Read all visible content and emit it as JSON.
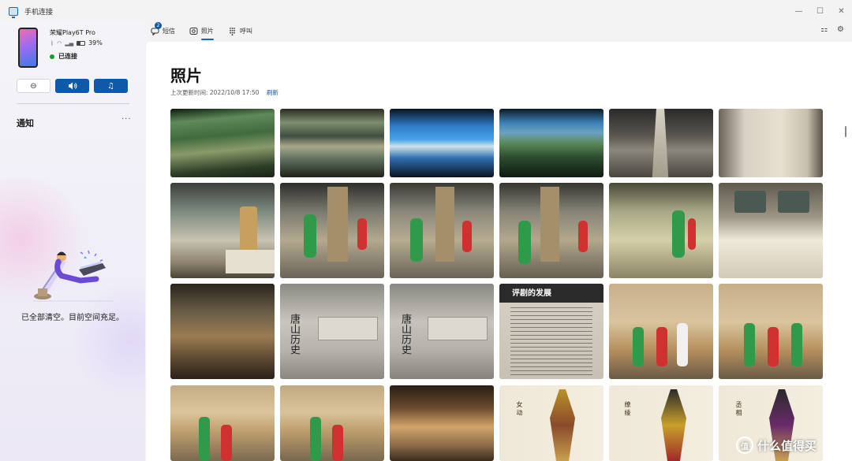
{
  "window": {
    "title": "手机连接",
    "controls": [
      "—",
      "☐",
      "✕"
    ]
  },
  "device": {
    "name": "荣耀Play6T Pro",
    "battery": "39%",
    "status": "已连接",
    "status_color": "#10a02b"
  },
  "controls": {
    "dnd_icon": "⊖",
    "volume_icon": "🔈",
    "music_icon": "♫"
  },
  "notifications": {
    "title": "通知",
    "more": "···",
    "empty_text": "已全部清空。目前空间充足。"
  },
  "tabs": [
    {
      "label": "短信",
      "icon": "message-icon",
      "badge": "2"
    },
    {
      "label": "照片",
      "icon": "photo-icon"
    },
    {
      "label": "呼叫",
      "icon": "dialpad-icon"
    }
  ],
  "active_tab": "照片",
  "main": {
    "title": "照片",
    "updated": "上次更新时间: 2022/10/8 17:50",
    "refresh": "刷新"
  },
  "photos": {
    "captions": {
      "tangshan_1": "唐山历史",
      "tangshan_2": "唐山历史",
      "gallery_heading": "评剧的发展",
      "figure_a": "女 动",
      "figure_b": "缭 绫",
      "figure_c": "丞 相"
    }
  },
  "watermark": {
    "text": "什么值得买",
    "icon": "值"
  },
  "accent_color": "#0f6cbd"
}
